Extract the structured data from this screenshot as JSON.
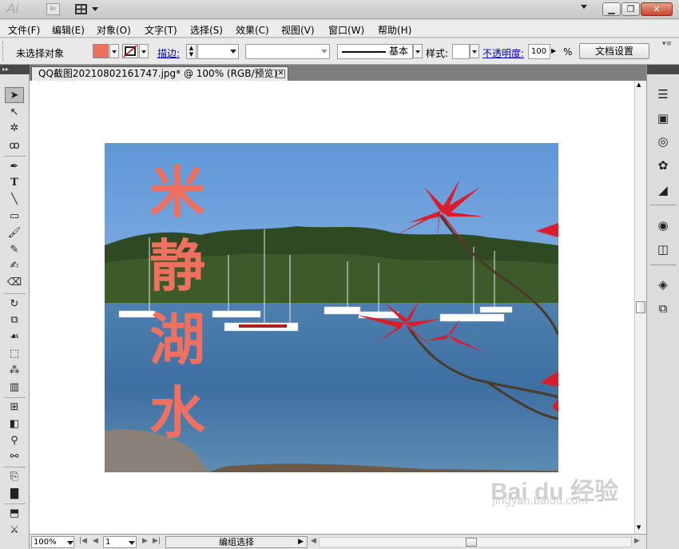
{
  "app": {
    "logo": "Ai",
    "bridge": "Br"
  },
  "menu": [
    "文件(F)",
    "编辑(E)",
    "对象(O)",
    "文字(T)",
    "选择(S)",
    "效果(C)",
    "视图(V)",
    "窗口(W)",
    "帮助(H)"
  ],
  "controlbar": {
    "selection_status": "未选择对象",
    "stroke_label": "描边:",
    "brush_label": "基本",
    "style_label": "样式:",
    "opacity_label": "不透明度:",
    "opacity_value": "100",
    "opacity_unit": "%",
    "doc_setup_button": "文档设置"
  },
  "colors": {
    "fill": "#f07060",
    "accent_link": "#0000c8",
    "title_text": "#f07060"
  },
  "document": {
    "tab_title": "QQ截图20210802161747.jpg* @ 100% (RGB/预览)",
    "artwork_text": [
      "米",
      "静",
      "湖",
      "水"
    ]
  },
  "statusbar": {
    "zoom": "100%",
    "page": "1",
    "status_text": "编组选择"
  },
  "tools": [
    "selection-icon",
    "direct-selection-icon",
    "magic-wand-icon",
    "lasso-icon",
    "pen-icon",
    "type-icon",
    "line-icon",
    "rectangle-icon",
    "paintbrush-icon",
    "pencil-icon",
    "blob-brush-icon",
    "eraser-icon",
    "rotate-icon",
    "scale-icon",
    "warp-icon",
    "free-transform-icon",
    "symbol-sprayer-icon",
    "graph-icon",
    "mesh-icon",
    "gradient-icon",
    "eyedropper-icon",
    "blend-icon",
    "artboard-icon",
    "slice-icon",
    "hand-icon",
    "zoom-icon"
  ],
  "panels": [
    "align-panel-icon",
    "swatches-icon",
    "color-guide-icon",
    "color-icon",
    "gradient-panel-icon",
    "appearance-icon",
    "transparency-icon",
    "layers-icon",
    "artboards-icon"
  ],
  "watermark": {
    "brand": "Bai du 经验",
    "url": "jingyan.baidu.com"
  }
}
